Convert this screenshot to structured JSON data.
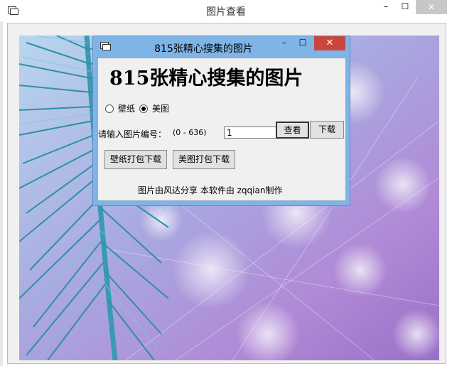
{
  "outer_window": {
    "title": "图片查看",
    "icon": "app-window-icon",
    "minimize_glyph": "–",
    "maximize_glyph": "☐",
    "close_glyph": "✕"
  },
  "dialog": {
    "title": "815张精心搜集的图片",
    "icon": "app-window-icon",
    "minimize_glyph": "–",
    "maximize_glyph": "☐",
    "close_glyph": "✕",
    "heading": "815张精心搜集的图片",
    "radios": [
      {
        "label": "壁纸",
        "checked": false
      },
      {
        "label": "美图",
        "checked": true
      }
    ],
    "prompt_label": "请输入图片编号：",
    "range_label": "(0 - 636)",
    "number_input_value": "1",
    "view_button": "查看",
    "download_button": "下载",
    "wallpaper_pack_button": "壁纸打包下载",
    "meitu_pack_button": "美图打包下载",
    "footer": "图片由风达分享 本软件由 zqqian制作"
  },
  "colors": {
    "dialog_frame": "#7fb4e6",
    "close_red": "#c9463d"
  }
}
